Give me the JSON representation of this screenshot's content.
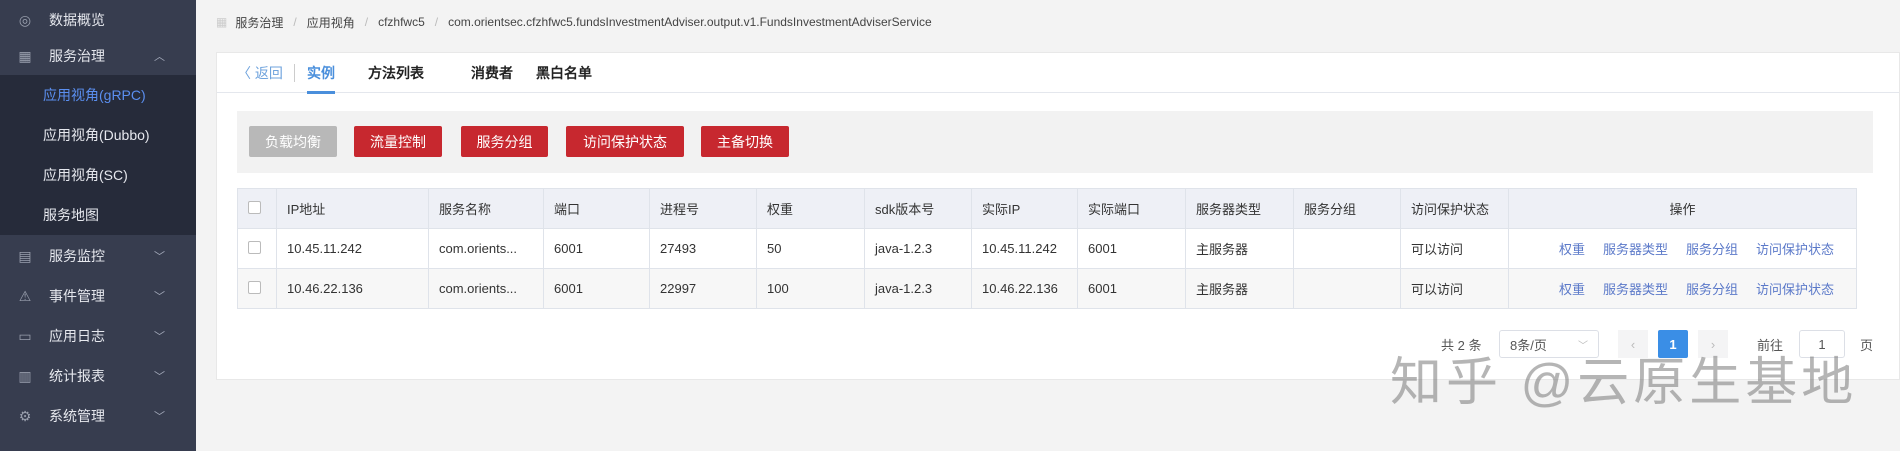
{
  "sidebar": {
    "items": [
      {
        "label": "数据概览",
        "icon": "dashboard-icon"
      },
      {
        "label": "服务治理",
        "icon": "grid-icon",
        "expanded": true
      },
      {
        "label": "服务监控",
        "icon": "monitor-icon"
      },
      {
        "label": "事件管理",
        "icon": "warning-icon"
      },
      {
        "label": "应用日志",
        "icon": "log-icon"
      },
      {
        "label": "统计报表",
        "icon": "bar-chart-icon"
      },
      {
        "label": "系统管理",
        "icon": "gear-icon"
      }
    ],
    "subitems": [
      "应用视角(gRPC)",
      "应用视角(Dubbo)",
      "应用视角(SC)",
      "服务地图"
    ]
  },
  "breadcrumb": [
    "服务治理",
    "应用视角",
    "cfzhfwc5",
    "com.orientsec.cfzhfwc5.fundsInvestmentAdviser.output.v1.FundsInvestmentAdviserService"
  ],
  "tabs": {
    "back": "返回",
    "items": [
      "实例",
      "方法列表",
      "消费者",
      "黑白名单"
    ]
  },
  "toolbar": {
    "buttons": [
      "负载均衡",
      "流量控制",
      "服务分组",
      "访问保护状态",
      "主备切换"
    ]
  },
  "table": {
    "headers": [
      "IP地址",
      "服务名称",
      "端口",
      "进程号",
      "权重",
      "sdk版本号",
      "实际IP",
      "实际端口",
      "服务器类型",
      "服务分组",
      "访问保护状态",
      "操作"
    ],
    "rows": [
      {
        "ip": "10.45.11.242",
        "name": "com.orients...",
        "port": "6001",
        "pid": "27493",
        "weight": "50",
        "sdk": "java-1.2.3",
        "real_ip": "10.45.11.242",
        "real_port": "6001",
        "type": "主服务器",
        "group": "",
        "status": "可以访问"
      },
      {
        "ip": "10.46.22.136",
        "name": "com.orients...",
        "port": "6001",
        "pid": "22997",
        "weight": "100",
        "sdk": "java-1.2.3",
        "real_ip": "10.46.22.136",
        "real_port": "6001",
        "type": "主服务器",
        "group": "",
        "status": "可以访问"
      }
    ],
    "actions": [
      "权重",
      "服务器类型",
      "服务分组",
      "访问保护状态"
    ]
  },
  "pager": {
    "total": "共 2 条",
    "page_size": "8条/页",
    "current": "1",
    "goto": "前往",
    "goto_value": "1",
    "page_unit": "页"
  },
  "watermark": "知乎 @云原生基地"
}
